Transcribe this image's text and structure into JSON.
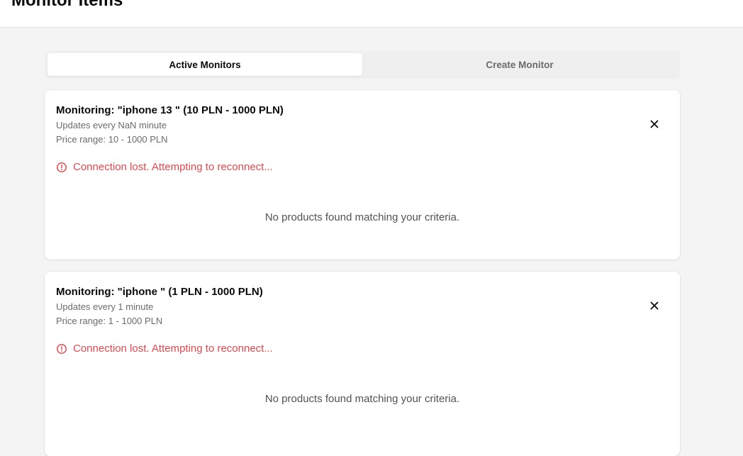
{
  "header": {
    "title": "Monitor Items"
  },
  "tabs": [
    {
      "label": "Active Monitors",
      "active": true
    },
    {
      "label": "Create Monitor",
      "active": false
    }
  ],
  "monitors": [
    {
      "title": "Monitoring: \"iphone 13 \" (10 PLN - 1000 PLN)",
      "interval": "Updates every NaN minute",
      "price_range": "Price range: 10 - 1000 PLN",
      "status": "Connection lost. Attempting to reconnect...",
      "empty_message": "No products found matching your criteria."
    },
    {
      "title": "Monitoring: \"iphone \" (1 PLN - 1000 PLN)",
      "interval": "Updates every 1 minute",
      "price_range": "Price range: 1 - 1000 PLN",
      "status": "Connection lost. Attempting to reconnect...",
      "empty_message": "No products found matching your criteria."
    }
  ],
  "icons": {
    "close": "close-icon",
    "alert": "alert-circle-icon"
  },
  "colors": {
    "error": "#e5484d",
    "background": "#f4f4f5",
    "card": "#ffffff"
  }
}
